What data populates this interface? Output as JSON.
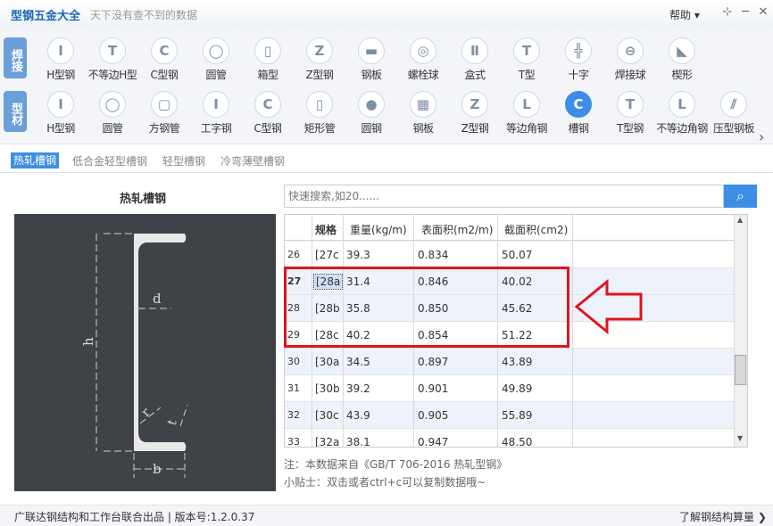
{
  "app": {
    "title": "型钢五金大全",
    "slogan": "天下没有查不到的数据"
  },
  "titlebar": {
    "help_label": "帮助"
  },
  "category_tabs": {
    "weld": "焊接",
    "profile": "型材"
  },
  "weld_tools": [
    "H型钢",
    "不等边H型",
    "C型钢",
    "圆管",
    "箱型",
    "Z型钢",
    "钢板",
    "螺栓球",
    "盒式",
    "T型",
    "十字",
    "焊接球",
    "楔形"
  ],
  "profile_tools": [
    "H型钢",
    "圆管",
    "方钢管",
    "工字钢",
    "C型钢",
    "矩形管",
    "圆钢",
    "钢板",
    "Z型钢",
    "等边角钢",
    "槽钢",
    "T型钢",
    "不等边角钢",
    "压型钢板"
  ],
  "subtabs": [
    "热轧槽钢",
    "低合金轻型槽钢",
    "轻型槽钢",
    "冷弯薄壁槽钢"
  ],
  "diagram": {
    "title": "热轧槽钢",
    "label_d": "d",
    "label_h": "h",
    "label_r": "r",
    "label_t": "t",
    "label_b": "b"
  },
  "search": {
    "placeholder": "快速搜索,如20......"
  },
  "table": {
    "headers": [
      "规格",
      "重量(kg/m)",
      "表面积(m2/m)",
      "截面积(cm2)"
    ],
    "rows": [
      {
        "num": "26",
        "spec": "[27c",
        "weight": "39.3",
        "area_s": "0.834",
        "area_x": "50.07"
      },
      {
        "num": "27",
        "spec": "[28a",
        "weight": "31.4",
        "area_s": "0.846",
        "area_x": "40.02"
      },
      {
        "num": "28",
        "spec": "[28b",
        "weight": "35.8",
        "area_s": "0.850",
        "area_x": "45.62"
      },
      {
        "num": "29",
        "spec": "[28c",
        "weight": "40.2",
        "area_s": "0.854",
        "area_x": "51.22"
      },
      {
        "num": "30",
        "spec": "[30a",
        "weight": "34.5",
        "area_s": "0.897",
        "area_x": "43.89"
      },
      {
        "num": "31",
        "spec": "[30b",
        "weight": "39.2",
        "area_s": "0.901",
        "area_x": "49.89"
      },
      {
        "num": "32",
        "spec": "[30c",
        "weight": "43.9",
        "area_s": "0.905",
        "area_x": "55.89"
      },
      {
        "num": "33",
        "spec": "[32a",
        "weight": "38.1",
        "area_s": "0.947",
        "area_x": "48.50"
      }
    ]
  },
  "notes": {
    "source": "注：本数据来自《GB/T 706-2016 热轧型钢》",
    "tip": "小贴士：双击或者ctrl+c可以复制数据哦~"
  },
  "footer": {
    "left": "广联达钢结构和工作台联合出品 | 版本号:1.2.0.37",
    "right": "了解钢结构算量"
  },
  "colors": {
    "accent": "#3c8ee6",
    "highlight": "#e0141e",
    "diagram_bg": "#3f4247"
  }
}
